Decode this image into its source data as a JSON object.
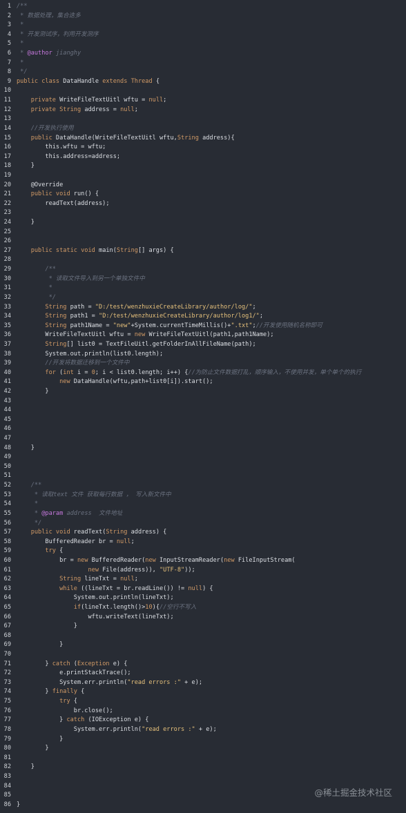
{
  "watermark": "@稀土掘金技术社区",
  "lines": [
    {
      "n": "1",
      "tokens": [
        {
          "t": "cmt",
          "v": "/**"
        }
      ]
    },
    {
      "n": "2",
      "tokens": [
        {
          "t": "cmt",
          "v": " * 数据处理，集合迭多"
        }
      ]
    },
    {
      "n": "3",
      "tokens": [
        {
          "t": "cmt",
          "v": " *"
        }
      ]
    },
    {
      "n": "4",
      "tokens": [
        {
          "t": "cmt",
          "v": " * 开发测试序，利用开发测序"
        }
      ]
    },
    {
      "n": "5",
      "tokens": [
        {
          "t": "cmt",
          "v": " *"
        }
      ]
    },
    {
      "n": "6",
      "tokens": [
        {
          "t": "cmt",
          "v": " * "
        },
        {
          "t": "ann",
          "v": "@author"
        },
        {
          "t": "cmt",
          "v": " jianghy"
        }
      ]
    },
    {
      "n": "7",
      "tokens": [
        {
          "t": "cmt",
          "v": " *"
        }
      ]
    },
    {
      "n": "8",
      "tokens": [
        {
          "t": "cmt",
          "v": " */"
        }
      ]
    },
    {
      "n": "9",
      "tokens": [
        {
          "t": "kw",
          "v": "public class "
        },
        {
          "t": "plain",
          "v": "DataHandle "
        },
        {
          "t": "kw",
          "v": "extends "
        },
        {
          "t": "type",
          "v": "Thread"
        },
        {
          "t": "plain",
          "v": " {"
        }
      ]
    },
    {
      "n": "10",
      "tokens": []
    },
    {
      "n": "11",
      "tokens": [
        {
          "t": "plain",
          "v": "    "
        },
        {
          "t": "kw",
          "v": "private "
        },
        {
          "t": "plain",
          "v": "WriteFileTextUitl wftu = "
        },
        {
          "t": "kw",
          "v": "null"
        },
        {
          "t": "plain",
          "v": ";"
        }
      ]
    },
    {
      "n": "12",
      "tokens": [
        {
          "t": "plain",
          "v": "    "
        },
        {
          "t": "kw",
          "v": "private "
        },
        {
          "t": "type",
          "v": "String"
        },
        {
          "t": "plain",
          "v": " address = "
        },
        {
          "t": "kw",
          "v": "null"
        },
        {
          "t": "plain",
          "v": ";"
        }
      ]
    },
    {
      "n": "13",
      "tokens": []
    },
    {
      "n": "14",
      "tokens": [
        {
          "t": "plain",
          "v": "    "
        },
        {
          "t": "cmt",
          "v": "//开发执行使用"
        }
      ]
    },
    {
      "n": "15",
      "tokens": [
        {
          "t": "plain",
          "v": "    "
        },
        {
          "t": "kw",
          "v": "public "
        },
        {
          "t": "plain",
          "v": "DataHandle(WriteFileTextUitl wftu,"
        },
        {
          "t": "type",
          "v": "String"
        },
        {
          "t": "plain",
          "v": " address){"
        }
      ]
    },
    {
      "n": "16",
      "tokens": [
        {
          "t": "plain",
          "v": "        this.wftu = wftu;"
        }
      ]
    },
    {
      "n": "17",
      "tokens": [
        {
          "t": "plain",
          "v": "        this.address=address;"
        }
      ]
    },
    {
      "n": "18",
      "tokens": [
        {
          "t": "plain",
          "v": "    }"
        }
      ]
    },
    {
      "n": "19",
      "tokens": []
    },
    {
      "n": "20",
      "tokens": [
        {
          "t": "plain",
          "v": "    @Override"
        }
      ]
    },
    {
      "n": "21",
      "tokens": [
        {
          "t": "plain",
          "v": "    "
        },
        {
          "t": "kw",
          "v": "public void "
        },
        {
          "t": "plain",
          "v": "run() {"
        }
      ]
    },
    {
      "n": "22",
      "tokens": [
        {
          "t": "plain",
          "v": "        readText(address);"
        }
      ]
    },
    {
      "n": "23",
      "tokens": []
    },
    {
      "n": "24",
      "tokens": [
        {
          "t": "plain",
          "v": "    }"
        }
      ]
    },
    {
      "n": "25",
      "tokens": []
    },
    {
      "n": "26",
      "tokens": []
    },
    {
      "n": "27",
      "tokens": [
        {
          "t": "plain",
          "v": "    "
        },
        {
          "t": "kw",
          "v": "public static void "
        },
        {
          "t": "plain",
          "v": "main("
        },
        {
          "t": "type",
          "v": "String"
        },
        {
          "t": "plain",
          "v": "[] args) {"
        }
      ]
    },
    {
      "n": "28",
      "tokens": []
    },
    {
      "n": "29",
      "tokens": [
        {
          "t": "plain",
          "v": "        "
        },
        {
          "t": "cmt",
          "v": "/**"
        }
      ]
    },
    {
      "n": "30",
      "tokens": [
        {
          "t": "plain",
          "v": "        "
        },
        {
          "t": "cmt",
          "v": " * 读取文件导入到另一个单独文件中"
        }
      ]
    },
    {
      "n": "31",
      "tokens": [
        {
          "t": "plain",
          "v": "        "
        },
        {
          "t": "cmt",
          "v": " *"
        }
      ]
    },
    {
      "n": "32",
      "tokens": [
        {
          "t": "plain",
          "v": "        "
        },
        {
          "t": "cmt",
          "v": " */"
        }
      ]
    },
    {
      "n": "33",
      "tokens": [
        {
          "t": "plain",
          "v": "        "
        },
        {
          "t": "type",
          "v": "String"
        },
        {
          "t": "plain",
          "v": " path = "
        },
        {
          "t": "str",
          "v": "\"D:/test/wenzhuxieCreateLibrary/author/log/\""
        },
        {
          "t": "plain",
          "v": ";"
        }
      ]
    },
    {
      "n": "34",
      "tokens": [
        {
          "t": "plain",
          "v": "        "
        },
        {
          "t": "type",
          "v": "String"
        },
        {
          "t": "plain",
          "v": " path1 = "
        },
        {
          "t": "str",
          "v": "\"D:/test/wenzhuxieCreateLibrary/author/log1/\""
        },
        {
          "t": "plain",
          "v": ";"
        }
      ]
    },
    {
      "n": "35",
      "tokens": [
        {
          "t": "plain",
          "v": "        "
        },
        {
          "t": "type",
          "v": "String"
        },
        {
          "t": "plain",
          "v": " path1Name = "
        },
        {
          "t": "str",
          "v": "\"new\""
        },
        {
          "t": "plain",
          "v": "+System.currentTimeMillis()+"
        },
        {
          "t": "str",
          "v": "\".txt\""
        },
        {
          "t": "plain",
          "v": ";"
        },
        {
          "t": "cmt",
          "v": "//开发使用随机名称即可"
        }
      ]
    },
    {
      "n": "36",
      "tokens": [
        {
          "t": "plain",
          "v": "        WriteFileTextUitl wftu = "
        },
        {
          "t": "kw",
          "v": "new "
        },
        {
          "t": "plain",
          "v": "WriteFileTextUitl(path1,path1Name);"
        }
      ]
    },
    {
      "n": "37",
      "tokens": [
        {
          "t": "plain",
          "v": "        "
        },
        {
          "t": "type",
          "v": "String"
        },
        {
          "t": "plain",
          "v": "[] list0 = TextFileUitl.getFolderInAllFileName(path);"
        }
      ]
    },
    {
      "n": "38",
      "tokens": [
        {
          "t": "plain",
          "v": "        System.out.println(list0.length);"
        }
      ]
    },
    {
      "n": "39",
      "tokens": [
        {
          "t": "plain",
          "v": "        "
        },
        {
          "t": "cmt",
          "v": "//开发将数据迁移到一个文件中"
        }
      ]
    },
    {
      "n": "40",
      "tokens": [
        {
          "t": "plain",
          "v": "        "
        },
        {
          "t": "kw",
          "v": "for "
        },
        {
          "t": "plain",
          "v": "("
        },
        {
          "t": "kw",
          "v": "int "
        },
        {
          "t": "plain",
          "v": "i = "
        },
        {
          "t": "num",
          "v": "0"
        },
        {
          "t": "plain",
          "v": "; i < list0.length; i++) {"
        },
        {
          "t": "cmt",
          "v": "//为防止文件数据打乱，顺序输入，不使用并发，单个单个的执行"
        }
      ]
    },
    {
      "n": "41",
      "tokens": [
        {
          "t": "plain",
          "v": "            "
        },
        {
          "t": "kw",
          "v": "new "
        },
        {
          "t": "plain",
          "v": "DataHandle(wftu,path+list0[i]).start();"
        }
      ]
    },
    {
      "n": "42",
      "tokens": [
        {
          "t": "plain",
          "v": "        }"
        }
      ]
    },
    {
      "n": "43",
      "tokens": []
    },
    {
      "n": "44",
      "tokens": []
    },
    {
      "n": "45",
      "tokens": []
    },
    {
      "n": "46",
      "tokens": []
    },
    {
      "n": "47",
      "tokens": []
    },
    {
      "n": "48",
      "tokens": [
        {
          "t": "plain",
          "v": "    }"
        }
      ]
    },
    {
      "n": "49",
      "tokens": []
    },
    {
      "n": "50",
      "tokens": []
    },
    {
      "n": "51",
      "tokens": []
    },
    {
      "n": "52",
      "tokens": [
        {
          "t": "plain",
          "v": "    "
        },
        {
          "t": "cmt",
          "v": "/**"
        }
      ]
    },
    {
      "n": "53",
      "tokens": [
        {
          "t": "plain",
          "v": "    "
        },
        {
          "t": "cmt",
          "v": " * 读取text 文件 获取每行数据 ， 写入新文件中"
        }
      ]
    },
    {
      "n": "54",
      "tokens": [
        {
          "t": "plain",
          "v": "    "
        },
        {
          "t": "cmt",
          "v": " *"
        }
      ]
    },
    {
      "n": "55",
      "tokens": [
        {
          "t": "plain",
          "v": "    "
        },
        {
          "t": "cmt",
          "v": " * "
        },
        {
          "t": "ann",
          "v": "@param"
        },
        {
          "t": "cmt",
          "v": " address  文件地址"
        }
      ]
    },
    {
      "n": "56",
      "tokens": [
        {
          "t": "plain",
          "v": "    "
        },
        {
          "t": "cmt",
          "v": " */"
        }
      ]
    },
    {
      "n": "57",
      "tokens": [
        {
          "t": "plain",
          "v": "    "
        },
        {
          "t": "kw",
          "v": "public void "
        },
        {
          "t": "plain",
          "v": "readText("
        },
        {
          "t": "type",
          "v": "String"
        },
        {
          "t": "plain",
          "v": " address) {"
        }
      ]
    },
    {
      "n": "58",
      "tokens": [
        {
          "t": "plain",
          "v": "        BufferedReader br = "
        },
        {
          "t": "kw",
          "v": "null"
        },
        {
          "t": "plain",
          "v": ";"
        }
      ]
    },
    {
      "n": "59",
      "tokens": [
        {
          "t": "plain",
          "v": "        "
        },
        {
          "t": "kw",
          "v": "try "
        },
        {
          "t": "plain",
          "v": "{"
        }
      ]
    },
    {
      "n": "60",
      "tokens": [
        {
          "t": "plain",
          "v": "            br = "
        },
        {
          "t": "kw",
          "v": "new "
        },
        {
          "t": "plain",
          "v": "BufferedReader("
        },
        {
          "t": "kw",
          "v": "new "
        },
        {
          "t": "plain",
          "v": "InputStreamReader("
        },
        {
          "t": "kw",
          "v": "new "
        },
        {
          "t": "plain",
          "v": "FileInputStream("
        }
      ]
    },
    {
      "n": "61",
      "tokens": [
        {
          "t": "plain",
          "v": "                    "
        },
        {
          "t": "kw",
          "v": "new "
        },
        {
          "t": "plain",
          "v": "File(address)), "
        },
        {
          "t": "str",
          "v": "\"UTF-8\""
        },
        {
          "t": "plain",
          "v": "));"
        }
      ]
    },
    {
      "n": "62",
      "tokens": [
        {
          "t": "plain",
          "v": "            "
        },
        {
          "t": "type",
          "v": "String"
        },
        {
          "t": "plain",
          "v": " lineTxt = "
        },
        {
          "t": "kw",
          "v": "null"
        },
        {
          "t": "plain",
          "v": ";"
        }
      ]
    },
    {
      "n": "63",
      "tokens": [
        {
          "t": "plain",
          "v": "            "
        },
        {
          "t": "kw",
          "v": "while "
        },
        {
          "t": "plain",
          "v": "((lineTxt = br.readLine()) != "
        },
        {
          "t": "kw",
          "v": "null"
        },
        {
          "t": "plain",
          "v": ") {"
        }
      ]
    },
    {
      "n": "64",
      "tokens": [
        {
          "t": "plain",
          "v": "                System.out.println(lineTxt);"
        }
      ]
    },
    {
      "n": "65",
      "tokens": [
        {
          "t": "plain",
          "v": "                "
        },
        {
          "t": "kw",
          "v": "if"
        },
        {
          "t": "plain",
          "v": "(lineTxt.length()>"
        },
        {
          "t": "num",
          "v": "10"
        },
        {
          "t": "plain",
          "v": "){"
        },
        {
          "t": "cmt",
          "v": "//空行不写入"
        }
      ]
    },
    {
      "n": "66",
      "tokens": [
        {
          "t": "plain",
          "v": "                    wftu.writeText(lineTxt);"
        }
      ]
    },
    {
      "n": "67",
      "tokens": [
        {
          "t": "plain",
          "v": "                }"
        }
      ]
    },
    {
      "n": "68",
      "tokens": []
    },
    {
      "n": "69",
      "tokens": [
        {
          "t": "plain",
          "v": "            }"
        }
      ]
    },
    {
      "n": "70",
      "tokens": []
    },
    {
      "n": "71",
      "tokens": [
        {
          "t": "plain",
          "v": "        } "
        },
        {
          "t": "kw",
          "v": "catch "
        },
        {
          "t": "plain",
          "v": "("
        },
        {
          "t": "type",
          "v": "Exception"
        },
        {
          "t": "plain",
          "v": " e) {"
        }
      ]
    },
    {
      "n": "72",
      "tokens": [
        {
          "t": "plain",
          "v": "            e.printStackTrace();"
        }
      ]
    },
    {
      "n": "73",
      "tokens": [
        {
          "t": "plain",
          "v": "            System.err.println("
        },
        {
          "t": "str",
          "v": "\"read errors :\""
        },
        {
          "t": "plain",
          "v": " + e);"
        }
      ]
    },
    {
      "n": "74",
      "tokens": [
        {
          "t": "plain",
          "v": "        } "
        },
        {
          "t": "kw",
          "v": "finally "
        },
        {
          "t": "plain",
          "v": "{"
        }
      ]
    },
    {
      "n": "75",
      "tokens": [
        {
          "t": "plain",
          "v": "            "
        },
        {
          "t": "kw",
          "v": "try "
        },
        {
          "t": "plain",
          "v": "{"
        }
      ]
    },
    {
      "n": "76",
      "tokens": [
        {
          "t": "plain",
          "v": "                br.close();"
        }
      ]
    },
    {
      "n": "77",
      "tokens": [
        {
          "t": "plain",
          "v": "            } "
        },
        {
          "t": "kw",
          "v": "catch "
        },
        {
          "t": "plain",
          "v": "(IOException e) {"
        }
      ]
    },
    {
      "n": "78",
      "tokens": [
        {
          "t": "plain",
          "v": "                System.err.println("
        },
        {
          "t": "str",
          "v": "\"read errors :\""
        },
        {
          "t": "plain",
          "v": " + e);"
        }
      ]
    },
    {
      "n": "79",
      "tokens": [
        {
          "t": "plain",
          "v": "            }"
        }
      ]
    },
    {
      "n": "80",
      "tokens": [
        {
          "t": "plain",
          "v": "        }"
        }
      ]
    },
    {
      "n": "81",
      "tokens": []
    },
    {
      "n": "82",
      "tokens": [
        {
          "t": "plain",
          "v": "    }"
        }
      ]
    },
    {
      "n": "83",
      "tokens": []
    },
    {
      "n": "84",
      "tokens": []
    },
    {
      "n": "85",
      "tokens": []
    },
    {
      "n": "86",
      "tokens": [
        {
          "t": "plain",
          "v": "}"
        }
      ]
    }
  ]
}
